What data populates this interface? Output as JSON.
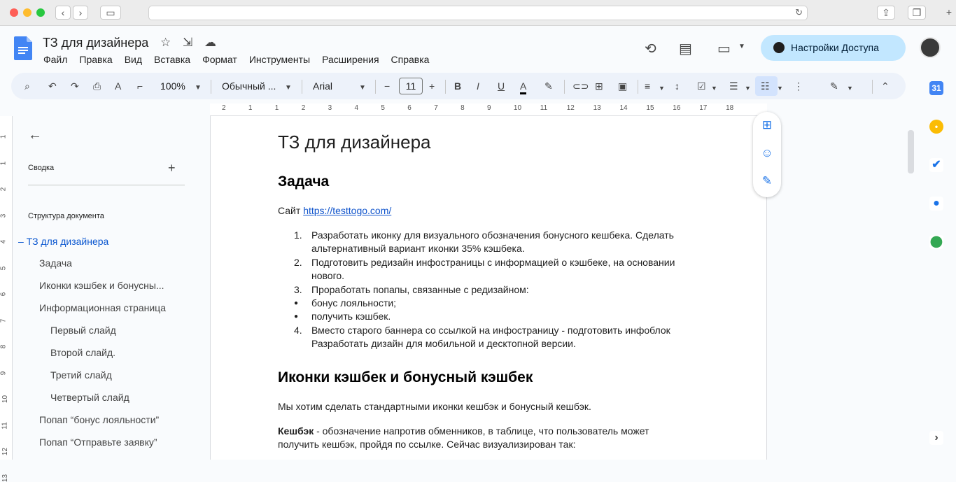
{
  "browser": {
    "url": "",
    "reload_icon": "reload-icon"
  },
  "docs": {
    "title": "ТЗ для дизайнера",
    "menu": [
      "Файл",
      "Правка",
      "Вид",
      "Вставка",
      "Формат",
      "Инструменты",
      "Расширения",
      "Справка"
    ],
    "share_label": "Настройки Доступа"
  },
  "toolbar": {
    "zoom": "100%",
    "style": "Обычный ...",
    "font": "Arial",
    "font_size": "11"
  },
  "ruler": {
    "h": [
      "2",
      "1",
      "1",
      "2",
      "3",
      "4",
      "5",
      "6",
      "7",
      "8",
      "9",
      "10",
      "11",
      "12",
      "13",
      "14",
      "15",
      "16",
      "17",
      "18"
    ],
    "v": [
      "1",
      "1",
      "2",
      "3",
      "4",
      "5",
      "6",
      "7",
      "8",
      "9",
      "10",
      "11",
      "12",
      "13"
    ]
  },
  "outline": {
    "summary_label": "Сводка",
    "structure_label": "Структура документа",
    "items": [
      {
        "label": "ТЗ для дизайнера",
        "marker": "–"
      },
      {
        "label": "Задача"
      },
      {
        "label": "Иконки кэшбек и бонусны..."
      },
      {
        "label": "Информационная страница"
      },
      {
        "label": "Первый слайд"
      },
      {
        "label": "Второй слайд."
      },
      {
        "label": "Третий слайд"
      },
      {
        "label": "Четвертый слайд"
      },
      {
        "label": "Попап “бонус лояльности”"
      },
      {
        "label": "Попап “Отправьте заявку”"
      }
    ]
  },
  "doc": {
    "title": "ТЗ для дизайнера",
    "h_task": "Задача",
    "site_label": "Сайт ",
    "site_link": "https://testtogo.com/",
    "list": [
      {
        "n": "1.",
        "lines": [
          "Разработать иконку для визуального обозначения бонусного кешбека. Сделать",
          "альтернативный вариант иконки 35% кэшбека."
        ]
      },
      {
        "n": "2.",
        "lines": [
          "Подготовить редизайн инфостраницы с информацией о кэшбеке, на основании",
          "нового."
        ]
      },
      {
        "n": "3.",
        "lines": [
          "Проработать попапы, связанные с редизайном:"
        ]
      },
      {
        "n": "●",
        "lines": [
          "бонус лояльности;"
        ]
      },
      {
        "n": "●",
        "lines": [
          "получить кэшбек."
        ]
      },
      {
        "n": "4.",
        "lines": [
          "Вместо старого баннера со ссылкой на инфостраницу - подготовить инфоблок",
          "Разработать дизайн для мобильной и десктопной версии."
        ]
      }
    ],
    "h_icons": "Иконки кэшбек и бонусный кэшбек",
    "p1": "Мы хотим сделать стандартными иконки кешбэк и бонусный кешбэк.",
    "p2_bold": "Кешбэк",
    "p2_rest": " - обозначение напротив обменников, в таблице, что пользователь может",
    "p2_line2": "получить кешбэк, пройдя по ссылке. Сейчас визуализирован так:"
  },
  "colors": {
    "accent": "#0b57d0",
    "share_bg": "#c2e7ff",
    "toolbar_bg": "#edf2fa",
    "list_active": "#d3e3fd"
  }
}
